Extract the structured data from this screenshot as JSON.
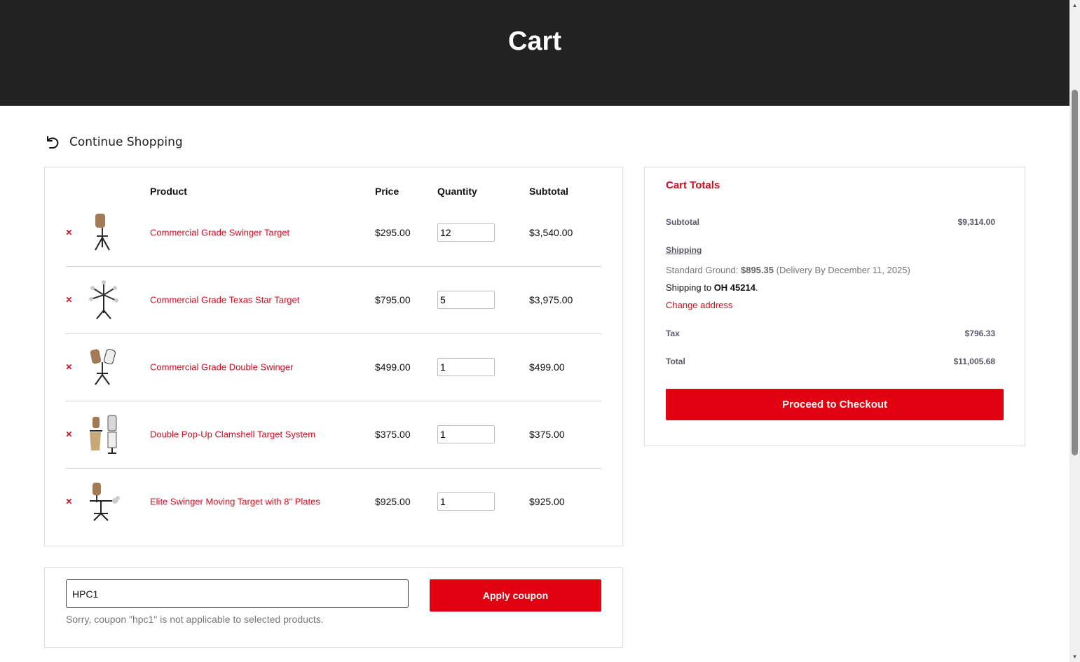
{
  "page": {
    "title": "Cart"
  },
  "nav": {
    "continue_label": "Continue Shopping"
  },
  "table": {
    "headers": {
      "product": "Product",
      "price": "Price",
      "quantity": "Quantity",
      "subtotal": "Subtotal"
    },
    "remove_symbol": "×",
    "items": [
      {
        "name": "Commercial Grade Swinger Target",
        "price": "$295.00",
        "quantity": "12",
        "subtotal": "$3,540.00"
      },
      {
        "name": "Commercial Grade Texas Star Target",
        "price": "$795.00",
        "quantity": "5",
        "subtotal": "$3,975.00"
      },
      {
        "name": "Commercial Grade Double Swinger",
        "price": "$499.00",
        "quantity": "1",
        "subtotal": "$499.00"
      },
      {
        "name": "Double Pop-Up Clamshell Target System",
        "price": "$375.00",
        "quantity": "1",
        "subtotal": "$375.00"
      },
      {
        "name": "Elite Swinger Moving Target with 8\" Plates",
        "price": "$925.00",
        "quantity": "1",
        "subtotal": "$925.00"
      }
    ]
  },
  "totals": {
    "heading": "Cart Totals",
    "subtotal_label": "Subtotal",
    "subtotal_value": "$9,314.00",
    "shipping_label": "Shipping",
    "shipping_method": "Standard Ground:",
    "shipping_cost": "$895.35",
    "shipping_delivery": "(Delivery By December 11, 2025)",
    "shipping_to_prefix": "Shipping to",
    "shipping_to_location": "OH 45214",
    "shipping_to_suffix": ".",
    "change_address": "Change address",
    "tax_label": "Tax",
    "tax_value": "$796.33",
    "total_label": "Total",
    "total_value": "$11,005.68",
    "checkout_label": "Proceed to Checkout"
  },
  "coupon": {
    "value": "HPC1",
    "apply_label": "Apply coupon",
    "message": "Sorry, coupon \"hpc1\" is not applicable to selected products."
  },
  "colors": {
    "header_bg": "#222222",
    "brand_red": "#e0000f",
    "link_red": "#c8101e"
  },
  "icons": {
    "continue": "undo-arrow-icon",
    "remove": "remove-x-icon",
    "scroll_up": "scroll-up-arrow-icon",
    "scroll_down": "scroll-down-arrow-icon"
  }
}
